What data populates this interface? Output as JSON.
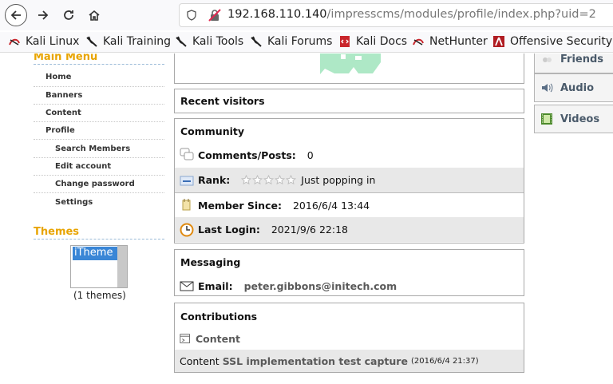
{
  "browser": {
    "url_host": "192.168.110.140",
    "url_path": "/impresscms/modules/profile/index.php?uid=2",
    "bookmarks": [
      "Kali Linux",
      "Kali Training",
      "Kali Tools",
      "Kali Forums",
      "Kali Docs",
      "NetHunter",
      "Offensive Security"
    ]
  },
  "sidebar": {
    "main_menu_title": "Main Menu",
    "menu": [
      "Home",
      "Banners",
      "Content",
      "Profile",
      "Search Members",
      "Edit account",
      "Change password",
      "Settings"
    ],
    "themes_title": "Themes",
    "theme_selected": "iTheme",
    "themes_count": "(1 themes)"
  },
  "right_tabs": [
    "Friends",
    "Audio",
    "Videos"
  ],
  "recent_visitors": {
    "title": "Recent visitors"
  },
  "community": {
    "title": "Community",
    "comments_label": "Comments/Posts:",
    "comments_value": "0",
    "rank_label": "Rank:",
    "rank_text": "Just popping in",
    "rank_stars": 0,
    "member_since_label": "Member Since:",
    "member_since_value": "2016/6/4 13:44",
    "last_login_label": "Last Login:",
    "last_login_value": "2021/9/6 22:18"
  },
  "messaging": {
    "title": "Messaging",
    "email_label": "Email:",
    "email_value": "peter.gibbons@initech.com"
  },
  "contributions": {
    "title": "Contributions",
    "section": "Content",
    "item_prefix": "Content",
    "item_link": "SSL implementation test capture",
    "item_date": "(2016/6/4 21:37)"
  },
  "colors": {
    "accent": "#e8a400",
    "link": "#5a5a5a",
    "shade": "#e8e8e8"
  }
}
